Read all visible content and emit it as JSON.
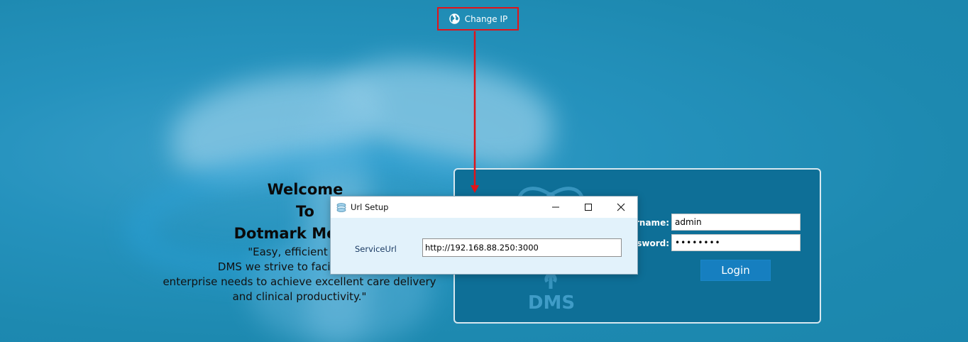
{
  "toolbar": {
    "change_ip_label": "Change IP",
    "change_ip_icon": "globe-icon"
  },
  "welcome": {
    "line1": "Welcome",
    "line2": "To",
    "line3": "Dotmark Medical",
    "quote_line1": "\"Easy, efficient and",
    "quote_line2": "DMS we strive to facilitate and",
    "quote_line3": "enterprise needs to achieve excellent care delivery",
    "quote_line4": "and clinical productivity.\""
  },
  "login": {
    "logo_text": "DMS",
    "username_label": "rname:",
    "username_value": "admin",
    "password_label": "sword:",
    "password_value": "••••••••",
    "login_button": "Login"
  },
  "dialog": {
    "title": "Url Setup",
    "service_url_label": "ServiceUrl",
    "service_url_value": "http://192.168.88.250:3000",
    "minimize_icon": "minimize-icon",
    "maximize_icon": "maximize-icon",
    "close_icon": "close-icon"
  },
  "colors": {
    "background": "#1e8ab0",
    "login_panel": "#0e6f97",
    "login_button": "#167fc0",
    "annotation_red": "#e0141a",
    "dialog_body": "#e2f2fb"
  }
}
